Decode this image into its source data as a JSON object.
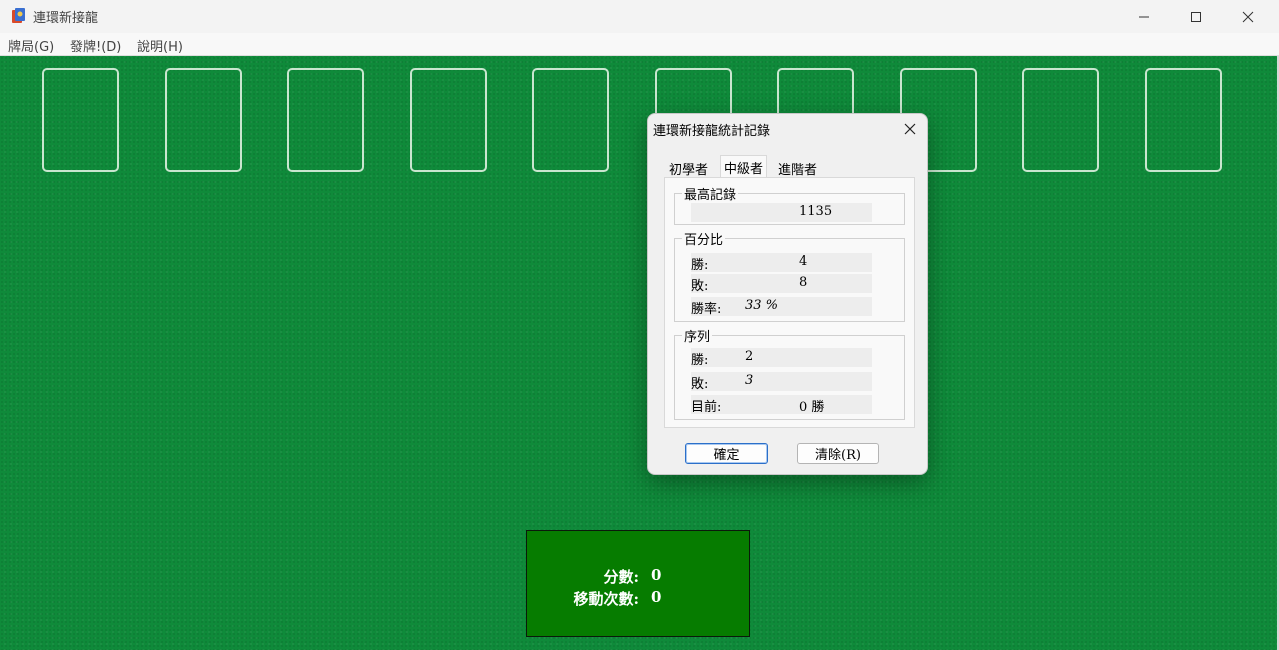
{
  "window": {
    "title": "連環新接龍"
  },
  "menu": {
    "items": [
      "牌局(G)",
      "發牌!(D)",
      "說明(H)"
    ]
  },
  "game": {
    "slot_count": 10,
    "score_label": "分數:",
    "score_value": "0",
    "moves_label": "移動次數:",
    "moves_value": "0"
  },
  "dialog": {
    "title": "連環新接龍統計記錄",
    "tabs": [
      "初學者",
      "中級者",
      "進階者"
    ],
    "active_tab": "中級者",
    "high_score": {
      "title": "最高記錄",
      "value": "1135"
    },
    "percentage": {
      "title": "百分比",
      "win_label": "勝:",
      "win_value": "4",
      "loss_label": "敗:",
      "loss_value": "8",
      "rate_label": "勝率:",
      "rate_value": "33 %"
    },
    "streaks": {
      "title": "序列",
      "win_label": "勝:",
      "win_value": "2",
      "loss_label": "敗:",
      "loss_value": "3",
      "current_label": "目前:",
      "current_value": "0 勝"
    },
    "ok_label": "確定",
    "clear_label": "清除(R)"
  },
  "colors": {
    "felt": "#0f8a3a",
    "score_box": "#067c00",
    "slot_outline": "#c9e6cf"
  }
}
